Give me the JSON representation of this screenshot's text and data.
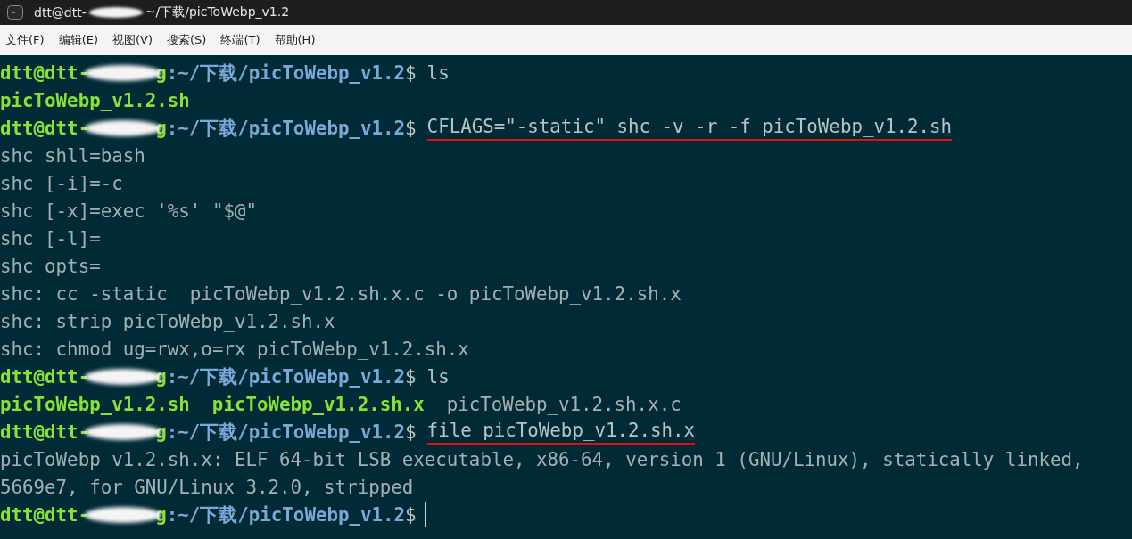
{
  "window": {
    "title_user": "dtt@dtt-",
    "title_path": "~/下载/picToWebp_v1.2"
  },
  "menu": [
    "文件(F)",
    "编辑(E)",
    "视图(V)",
    "搜索(S)",
    "终端(T)",
    "帮助(H)"
  ],
  "lines": [
    {
      "kind": "prompt",
      "user": "dtt@dtt-",
      "host_tail": "g",
      "path": ":~/下载/picToWebp_v1.2",
      "sign": "$",
      "command": "ls",
      "underlined": false
    },
    {
      "kind": "output",
      "segments": [
        {
          "text": "picToWebp_v1.2.sh",
          "kind": "exec"
        }
      ]
    },
    {
      "kind": "prompt",
      "user": "dtt@dtt-",
      "host_tail": "g",
      "path": ":~/下载/picToWebp_v1.2",
      "sign": "$",
      "command": "CFLAGS=\"-static\" shc -v -r -f picToWebp_v1.2.sh",
      "underlined": true
    },
    {
      "kind": "output",
      "segments": [
        {
          "text": "shc shll=bash",
          "kind": "plain"
        }
      ]
    },
    {
      "kind": "output",
      "segments": [
        {
          "text": "shc [-i]=-c",
          "kind": "plain"
        }
      ]
    },
    {
      "kind": "output",
      "segments": [
        {
          "text": "shc [-x]=exec '%s' \"$@\"",
          "kind": "plain"
        }
      ]
    },
    {
      "kind": "output",
      "segments": [
        {
          "text": "shc [-l]=",
          "kind": "plain"
        }
      ]
    },
    {
      "kind": "output",
      "segments": [
        {
          "text": "shc opts=",
          "kind": "plain"
        }
      ]
    },
    {
      "kind": "output",
      "segments": [
        {
          "text": "shc: cc -static  picToWebp_v1.2.sh.x.c -o picToWebp_v1.2.sh.x",
          "kind": "plain"
        }
      ]
    },
    {
      "kind": "output",
      "segments": [
        {
          "text": "shc: strip picToWebp_v1.2.sh.x",
          "kind": "plain"
        }
      ]
    },
    {
      "kind": "output",
      "segments": [
        {
          "text": "shc: chmod ug=rwx,o=rx picToWebp_v1.2.sh.x",
          "kind": "plain"
        }
      ]
    },
    {
      "kind": "prompt",
      "user": "dtt@dtt-",
      "host_tail": "g",
      "path": ":~/下载/picToWebp_v1.2",
      "sign": "$",
      "command": "ls",
      "underlined": false
    },
    {
      "kind": "output",
      "segments": [
        {
          "text": "picToWebp_v1.2.sh",
          "kind": "exec"
        },
        {
          "text": "picToWebp_v1.2.sh.x",
          "kind": "exec"
        },
        {
          "text": "picToWebp_v1.2.sh.x.c",
          "kind": "plain"
        }
      ]
    },
    {
      "kind": "prompt",
      "user": "dtt@dtt-",
      "host_tail": "g",
      "path": ":~/下载/picToWebp_v1.2",
      "sign": "$",
      "command": "file picToWebp_v1.2.sh.x",
      "underlined": true
    },
    {
      "kind": "output",
      "segments": [
        {
          "text": "picToWebp_v1.2.sh.x: ELF 64-bit LSB executable, x86-64, version 1 (GNU/Linux), statically linked,",
          "kind": "plain"
        }
      ]
    },
    {
      "kind": "output",
      "segments": [
        {
          "text": "5669e7, for GNU/Linux 3.2.0, stripped",
          "kind": "plain"
        }
      ]
    },
    {
      "kind": "prompt",
      "user": "dtt@dtt-",
      "host_tail": "g",
      "path": ":~/下载/picToWebp_v1.2",
      "sign": "$",
      "cursor": true
    }
  ]
}
